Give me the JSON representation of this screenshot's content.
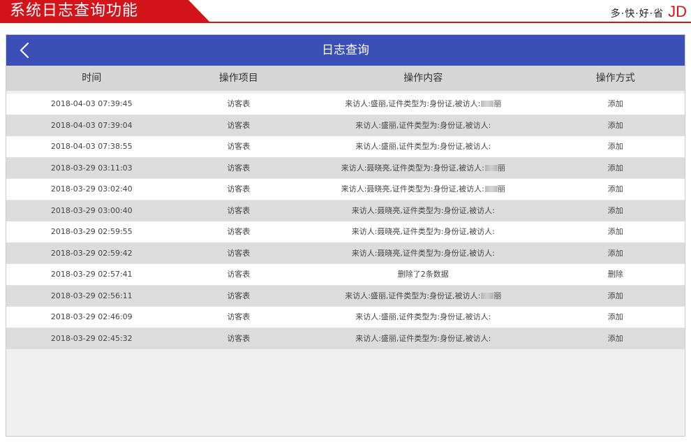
{
  "banner": {
    "title": "系统日志查询功能",
    "slogan": "多·快·好·省",
    "brand": "JD",
    "accent_color": "#d3141b"
  },
  "appbar": {
    "title": "日志查询",
    "back_icon": "chevron-left-icon",
    "color": "#3b4fb7"
  },
  "table": {
    "columns": [
      "时间",
      "操作项目",
      "操作内容",
      "操作方式"
    ],
    "rows": [
      {
        "time": "2018-04-03 07:39:45",
        "item": "访客表",
        "content": "来访人:盛丽,证件类型为:身份证,被访人:",
        "suffix": "丽",
        "blur": true,
        "method": "添加"
      },
      {
        "time": "2018-04-03 07:39:04",
        "item": "访客表",
        "content": "来访人:盛丽,证件类型为:身份证,被访人:",
        "suffix": "",
        "blur": false,
        "method": "添加"
      },
      {
        "time": "2018-04-03 07:38:55",
        "item": "访客表",
        "content": "来访人:盛丽,证件类型为:身份证,被访人:",
        "suffix": "",
        "blur": false,
        "method": "添加"
      },
      {
        "time": "2018-03-29 03:11:03",
        "item": "访客表",
        "content": "来访人:聂晓亮,证件类型为:身份证,被访人:",
        "suffix": "丽",
        "blur": true,
        "method": "添加"
      },
      {
        "time": "2018-03-29 03:02:40",
        "item": "访客表",
        "content": "来访人:聂晓亮,证件类型为:身份证,被访人:",
        "suffix": "丽",
        "blur": true,
        "method": "添加"
      },
      {
        "time": "2018-03-29 03:00:40",
        "item": "访客表",
        "content": "来访人:聂晓亮,证件类型为:身份证,被访人:",
        "suffix": "",
        "blur": false,
        "method": "添加"
      },
      {
        "time": "2018-03-29 02:59:55",
        "item": "访客表",
        "content": "来访人:聂晓亮,证件类型为:身份证,被访人:",
        "suffix": "",
        "blur": false,
        "method": "添加"
      },
      {
        "time": "2018-03-29 02:59:42",
        "item": "访客表",
        "content": "来访人:聂晓亮,证件类型为:身份证,被访人:",
        "suffix": "",
        "blur": false,
        "method": "添加"
      },
      {
        "time": "2018-03-29 02:57:41",
        "item": "访客表",
        "content": "删除了2条数据",
        "suffix": "",
        "blur": false,
        "method": "删除"
      },
      {
        "time": "2018-03-29 02:56:11",
        "item": "访客表",
        "content": "来访人:盛丽,证件类型为:身份证,被访人:",
        "suffix": "丽",
        "blur": true,
        "method": "添加"
      },
      {
        "time": "2018-03-29 02:46:09",
        "item": "访客表",
        "content": "来访人:盛丽,证件类型为:身份证,被访人:",
        "suffix": "",
        "blur": false,
        "method": "添加"
      },
      {
        "time": "2018-03-29 02:45:32",
        "item": "访客表",
        "content": "来访人:盛丽,证件类型为:身份证,被访人:",
        "suffix": "",
        "blur": false,
        "method": "添加"
      }
    ]
  }
}
